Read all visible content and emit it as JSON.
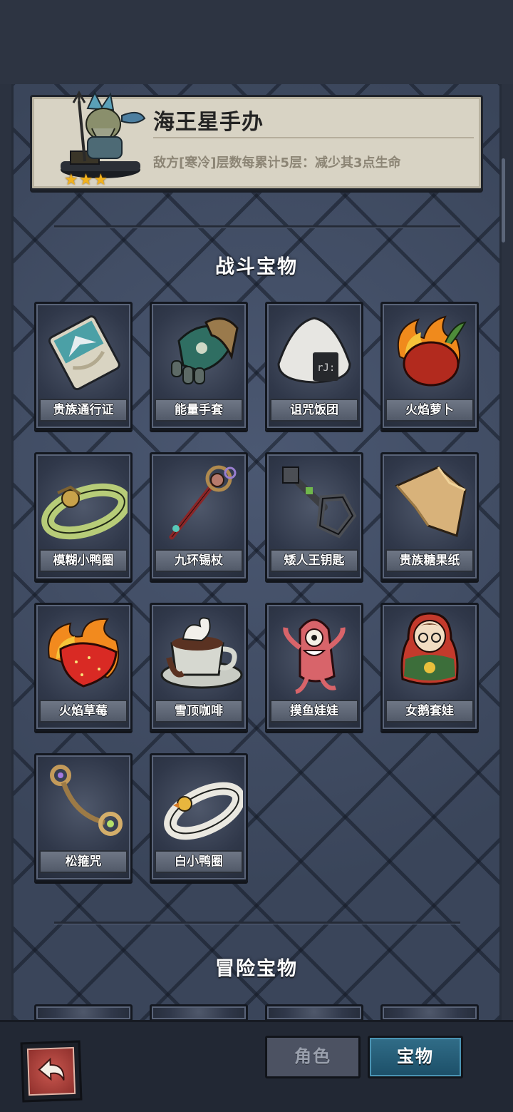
{
  "selected_item": {
    "name": "海王星手办",
    "description": "敌方[寒冷]层数每累计5层：减少其3点生命",
    "stars": [
      "★",
      "★",
      "★"
    ]
  },
  "sections": {
    "battle_title": "战斗宝物",
    "adventure_title": "冒险宝物"
  },
  "battle_items": [
    {
      "label": "贵族通行证"
    },
    {
      "label": "能量手套"
    },
    {
      "label": "诅咒饭团"
    },
    {
      "label": "火焰萝卜"
    },
    {
      "label": "模糊小鸭圈"
    },
    {
      "label": "九环锡杖"
    },
    {
      "label": "矮人王钥匙"
    },
    {
      "label": "贵族糖果纸"
    },
    {
      "label": "火焰草莓"
    },
    {
      "label": "雪顶咖啡"
    },
    {
      "label": "摸鱼娃娃"
    },
    {
      "label": "女鹅套娃"
    },
    {
      "label": "松箍咒"
    },
    {
      "label": "白小鸭圈"
    }
  ],
  "bottom_nav": {
    "tab_role": "角色",
    "tab_treasure": "宝物",
    "active_tab": "宝物"
  },
  "colors": {
    "panel": "#3e4a5f",
    "active_tab": "#1c4f68",
    "star": "#f2b21d"
  }
}
